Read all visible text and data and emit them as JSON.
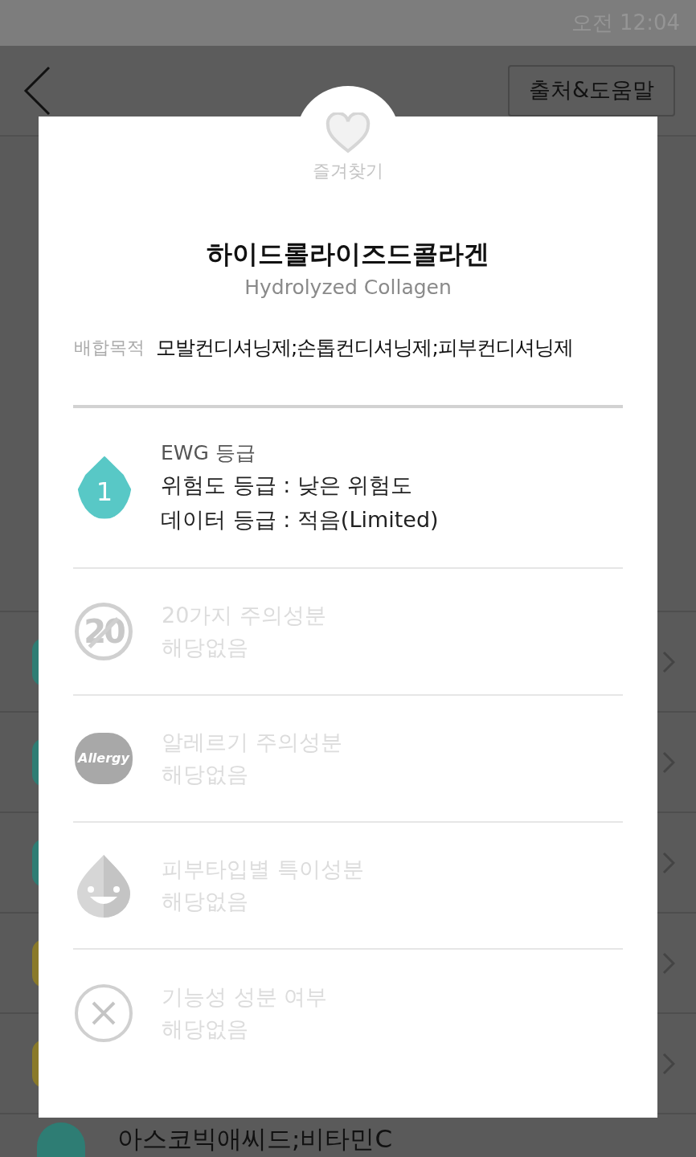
{
  "status_bar": {
    "time": "오전 12:04"
  },
  "header": {
    "help_button": "출처&도움말"
  },
  "background_rows": [
    {
      "color": "#2e7d74"
    },
    {
      "color": "#2e7d74"
    },
    {
      "color": "#2e7d74"
    },
    {
      "color": "#8a7a2a"
    },
    {
      "color": "#8a7a2a"
    }
  ],
  "last_row": {
    "color": "#2e7d74",
    "name": "아스코빅애씨드;비타민C"
  },
  "modal": {
    "favorite": {
      "label": "즐겨찾기",
      "on": false
    },
    "name_ko": "하이드롤라이즈드콜라겐",
    "name_en": "Hydrolyzed Collagen",
    "purpose": {
      "label": "배합목적",
      "value": "모발컨디셔닝제;손톱컨디셔닝제;피부컨디셔닝제"
    },
    "ewg": {
      "grade": "1",
      "title": "EWG 등급",
      "lines": [
        "위험도 등급 : 낮은 위험도",
        "데이터 등급 : 적음(Limited)"
      ]
    },
    "checks": [
      {
        "kind": "twenty",
        "title": "20가지 주의성분",
        "value": "해당없음",
        "icon_text": "20"
      },
      {
        "kind": "allergy",
        "title": "알레르기 주의성분",
        "value": "해당없음",
        "icon_text": "Allergy"
      },
      {
        "kind": "skin",
        "title": "피부타입별 특이성분",
        "value": "해당없음"
      },
      {
        "kind": "functional",
        "title": "기능성 성분 여부",
        "value": "해당없음"
      }
    ]
  }
}
